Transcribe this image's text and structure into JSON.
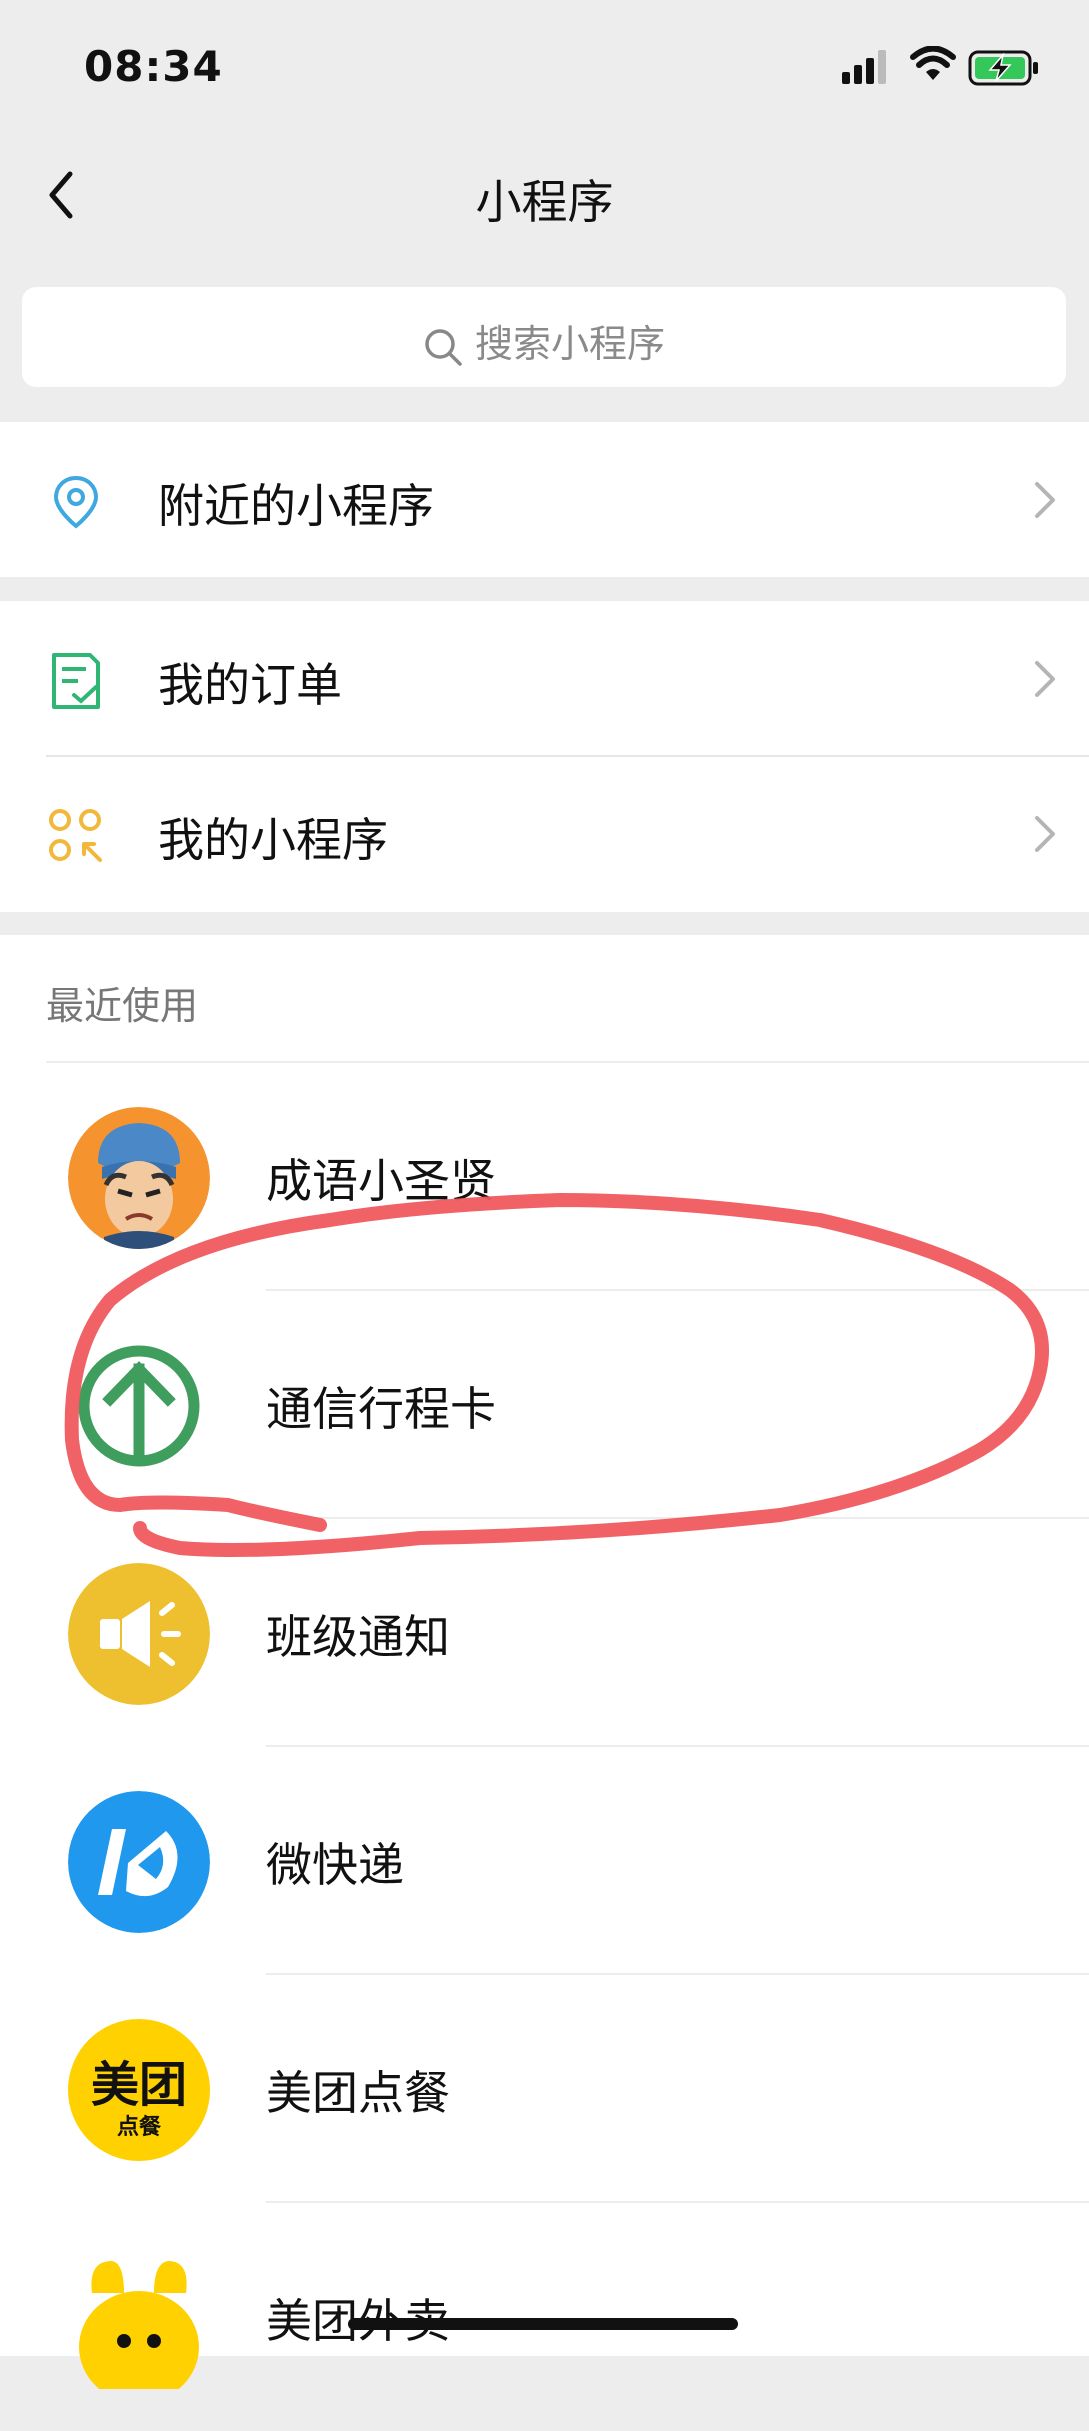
{
  "status_bar": {
    "time": "08:34"
  },
  "nav": {
    "title": "小程序"
  },
  "search": {
    "placeholder": "搜索小程序"
  },
  "menu": {
    "nearby": "附近的小程序",
    "orders": "我的订单",
    "my_apps": "我的小程序"
  },
  "recent": {
    "header": "最近使用",
    "apps": [
      {
        "name": "成语小圣贤",
        "icon": "cartoon-avatar-icon"
      },
      {
        "name": "通信行程卡",
        "icon": "green-up-arrow-icon"
      },
      {
        "name": "班级通知",
        "icon": "megaphone-icon"
      },
      {
        "name": "微快递",
        "icon": "kuaidi-logo-icon"
      },
      {
        "name": "美团点餐",
        "icon": "meituan-diancan-logo",
        "logo_text": "美团",
        "logo_sub": "点餐"
      },
      {
        "name": "美团外卖",
        "icon": "meituan-waimai-rabbit-icon"
      }
    ]
  },
  "colors": {
    "accent_green": "#07c160",
    "annotation_red": "#f05a5f",
    "megaphone_yellow": "#f0c22e",
    "kuaidi_blue": "#1f98ee",
    "meituan_yellow": "#ffd100"
  }
}
